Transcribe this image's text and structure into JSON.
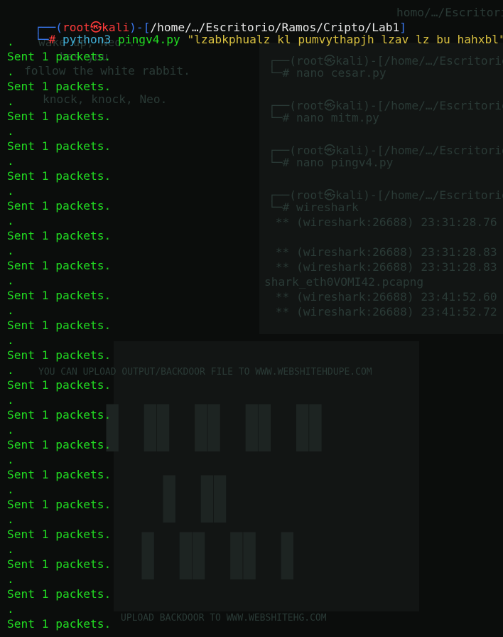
{
  "terminal": {
    "prompt_line1": {
      "corner": "┌──(",
      "user": "root",
      "at": "㉿",
      "host": "kali",
      "sep": ")-[",
      "path": "/home/…/Escritorio/Ramos/Cripto/Lab1",
      "close": "]"
    },
    "prompt_line2": {
      "corner": "└─",
      "hash": "#",
      "cmd": "python3",
      "script": "pingv4.py",
      "arg": "\"lzabkphualz kl pumvythapjh lzav lz bu hahxbl\""
    },
    "output": [
      {
        "dot": ".",
        "text": "Sent 1 packets."
      },
      {
        "dot": ".",
        "text": "Sent 1 packets."
      },
      {
        "dot": ".",
        "text": "Sent 1 packets."
      },
      {
        "dot": ".",
        "text": "Sent 1 packets."
      },
      {
        "dot": ".",
        "text": "Sent 1 packets."
      },
      {
        "dot": ".",
        "text": "Sent 1 packets."
      },
      {
        "dot": ".",
        "text": "Sent 1 packets."
      },
      {
        "dot": ".",
        "text": "Sent 1 packets."
      },
      {
        "dot": ".",
        "text": "Sent 1 packets."
      },
      {
        "dot": ".",
        "text": "Sent 1 packets."
      },
      {
        "dot": ".",
        "text": "Sent 1 packets."
      },
      {
        "dot": ".",
        "text": "Sent 1 packets."
      },
      {
        "dot": ".",
        "text": "Sent 1 packets."
      },
      {
        "dot": ".",
        "text": "Sent 1 packets."
      },
      {
        "dot": ".",
        "text": "Sent 1 packets."
      },
      {
        "dot": ".",
        "text": "Sent 1 packets."
      },
      {
        "dot": ".",
        "text": "Sent 1 packets."
      },
      {
        "dot": ".",
        "text": "Sent 1 packets."
      },
      {
        "dot": ".",
        "text": "Sent 1 packets."
      },
      {
        "dot": ".",
        "text": "Sent 1 packets."
      }
    ]
  },
  "background": {
    "lines": [
      "wake up, Neo...",
      "has you",
      "follow the white rabbit.",
      "knock, knock, Neo.",
      "┌──(root㉿kali)-[/home/…/Escritorio",
      "└─# nano cesar.py",
      "┌──(root㉿kali)-[/home/…/Escritorio",
      "└─# nano mitm.py",
      "┌──(root㉿kali)-[/home/…/Escritorio",
      "└─# nano pingv4.py",
      "┌──(root㉿kali)-[/home/…/Escritorio",
      "└─# wireshark",
      " ** (wireshark:26688) 23:31:28.76",
      " ** (wireshark:26688) 23:31:28.83",
      " ** (wireshark:26688) 23:31:28.83",
      "shark_eth0VOMI42.pcapng",
      " ** (wireshark:26688) 23:41:52.60",
      " ** (wireshark:26688) 23:41:52.72",
      "homo/…/Escritori",
      "YOU CAN UPLOAD OUTPUT/BACKDOOR FILE TO WWW.WEBSHITEHDUPE.COM",
      "UPLOAD BACKDOOR TO WWW.WEBSHITEHG.COM"
    ]
  }
}
